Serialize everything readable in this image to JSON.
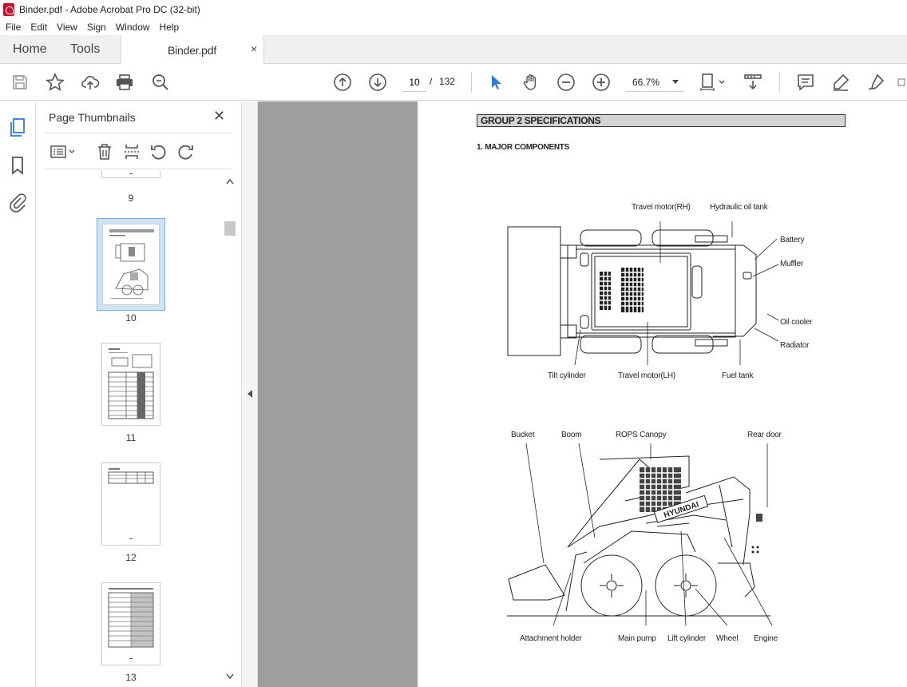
{
  "window": {
    "title": "Binder.pdf - Adobe Acrobat Pro DC (32-bit)"
  },
  "menu": [
    "File",
    "Edit",
    "View",
    "Sign",
    "Window",
    "Help"
  ],
  "tabs": {
    "home": "Home",
    "tools": "Tools",
    "document": "Binder.pdf",
    "close": "×"
  },
  "toolbar": {
    "page_current": "10",
    "page_separator": "/",
    "page_total": "132",
    "zoom": "66.7%"
  },
  "panel": {
    "title": "Page Thumbnails",
    "close": "✕",
    "thumbnails": [
      {
        "label": "9"
      },
      {
        "label": "10",
        "selected": true
      },
      {
        "label": "11"
      },
      {
        "label": "12"
      },
      {
        "label": "13"
      }
    ]
  },
  "document": {
    "group_header": "GROUP  2  SPECIFICATIONS",
    "section": "1. MAJOR COMPONENTS",
    "top_view_labels": {
      "travel_motor_rh": "Travel motor(RH)",
      "hydraulic_oil_tank": "Hydraulic oil tank",
      "battery": "Battery",
      "muffler": "Muffler",
      "oil_cooler": "Oil cooler",
      "radiator": "Radiator",
      "tilt_cylinder": "Tilt cylinder",
      "travel_motor_lh": "Travel motor(LH)",
      "fuel_tank": "Fuel tank"
    },
    "side_view_labels": {
      "bucket": "Bucket",
      "boom": "Boom",
      "rops_canopy": "ROPS Canopy",
      "rear_door": "Rear door",
      "attachment_holder": "Attachment holder",
      "main_pump": "Main pump",
      "lift_cylinder": "Lift cylinder",
      "wheel": "Wheel",
      "engine": "Engine",
      "brand": "HYUNDAI"
    }
  },
  "colors": {
    "doc_bg": "#9e9e9e",
    "accent": "#2d7be5",
    "selected_thumb": "#cfe3f7"
  }
}
